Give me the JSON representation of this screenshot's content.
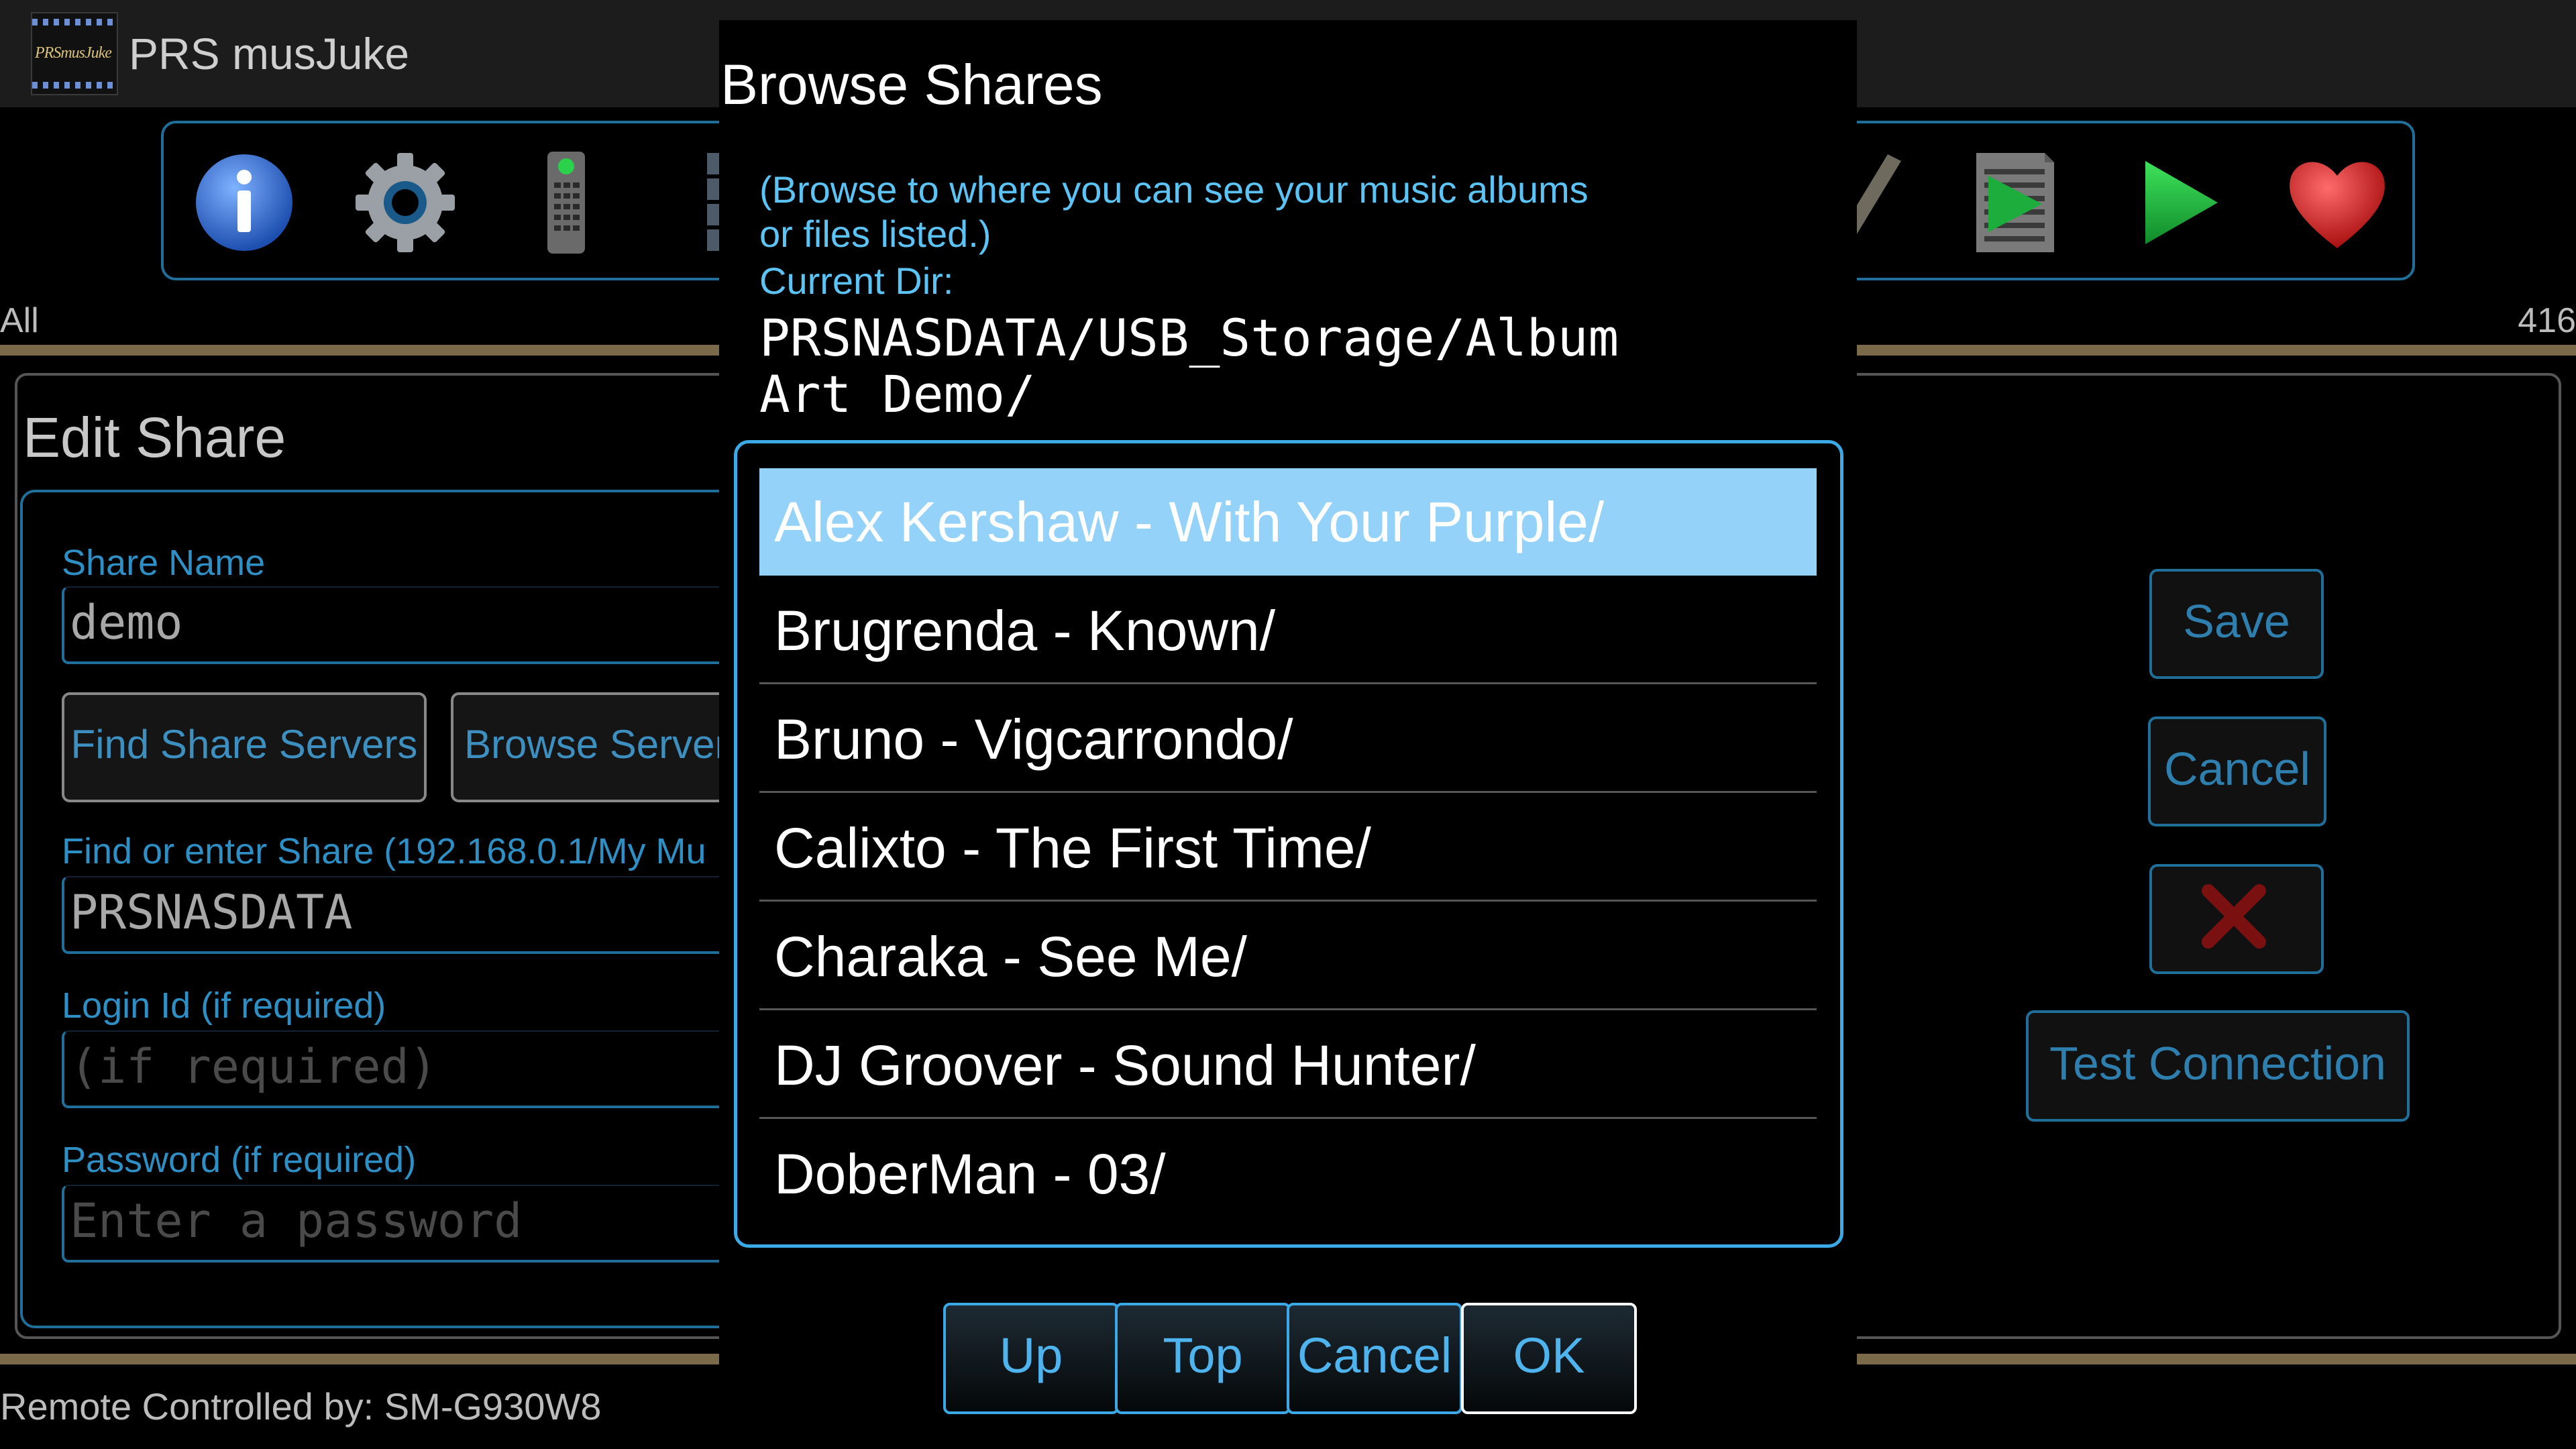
{
  "app": {
    "title": "PRS musJuke",
    "logo_text": "PRSmusJuke",
    "toolbar_icons": [
      "info-icon",
      "settings-gear-icon",
      "remote-control-icon",
      "grid-view-icon",
      "edit-pen-icon",
      "playlist-icon",
      "play-icon",
      "favorite-heart-icon"
    ],
    "filter_label": "All",
    "count_label": "416",
    "footer": "Remote Controlled by: SM-G930W8",
    "accent_color": "#1f6f9a",
    "gold_bar_color": "#7a6a4a"
  },
  "edit_share": {
    "title": "Edit Share",
    "share_name_label": "Share Name",
    "share_name_value": "demo",
    "find_servers_button": "Find Share Servers",
    "browse_servers_button": "Browse Server",
    "share_label": "Find or enter Share (192.168.0.1/My Mu",
    "share_value": "PRSNASDATA",
    "login_label": "Login Id (if required)",
    "login_placeholder": "(if required)",
    "password_label": "Password (if required)",
    "password_placeholder": "Enter a password",
    "save_button": "Save",
    "cancel_button": "Cancel",
    "delete_button_icon": "red-x-icon",
    "test_connection_button": "Test Connection"
  },
  "dialog": {
    "title": "Browse Shares",
    "hint_line1": "(Browse to where you can see your music albums",
    "hint_line2": "or files listed.)",
    "current_dir_label": "Current Dir:",
    "path_line1": "PRSNASDATA/USB_Storage/Album",
    "path_line2": "Art Demo/",
    "selected_color": "#94d2fa",
    "items": [
      "Alex Kershaw - With Your Purple/",
      "Brugrenda - Known/",
      "Bruno - Vigcarrondo/",
      "Calixto - The First Time/",
      "Charaka - See Me/",
      "DJ Groover - Sound Hunter/",
      "DoberMan - 03/"
    ],
    "buttons": {
      "up": "Up",
      "top": "Top",
      "cancel": "Cancel",
      "ok": "OK"
    }
  }
}
